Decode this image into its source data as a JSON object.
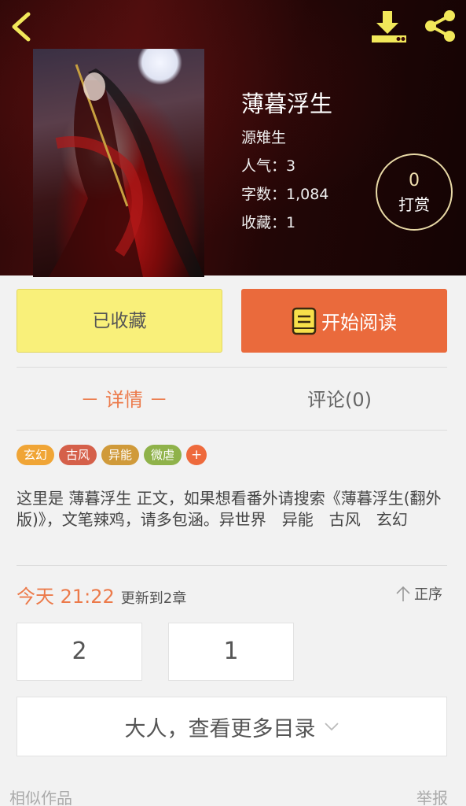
{
  "book": {
    "title": "薄暮浮生",
    "author": "源雉生",
    "popularity": "人气：3",
    "word_count": "字数：1,084",
    "favorites": "收藏：1"
  },
  "tip": {
    "count": "0",
    "label": "打赏"
  },
  "actions": {
    "favorite_label": "已收藏",
    "read_label": "开始阅读"
  },
  "tabs": {
    "detail": "－ 详情 －",
    "comments": "评论(0)"
  },
  "tags": [
    {
      "label": "玄幻",
      "color": "#f0a536"
    },
    {
      "label": "古风",
      "color": "#d5604a"
    },
    {
      "label": "异能",
      "color": "#d09a3a"
    },
    {
      "label": "微虐",
      "color": "#8fb24a"
    },
    {
      "label": "+",
      "color": "#ee6a3c"
    }
  ],
  "description": "这里是 薄暮浮生 正文，如果想看番外请搜索《薄暮浮生(翻外版)》，文笔辣鸡，请多包涵。异世界　异能　古风　玄幻",
  "update": {
    "time": "今天 21:22",
    "text": "更新到2章"
  },
  "sort_label": "正序",
  "chapters": [
    "2",
    "1"
  ],
  "more_catalog": "大人，查看更多目录",
  "footer": {
    "similar": "相似作品",
    "report": "举报"
  },
  "colors": {
    "accent": "#ec7a4a",
    "read_button": "#ea6a3c",
    "favorite_button": "#f9f07a",
    "icon_yellow": "#f2e85a"
  }
}
